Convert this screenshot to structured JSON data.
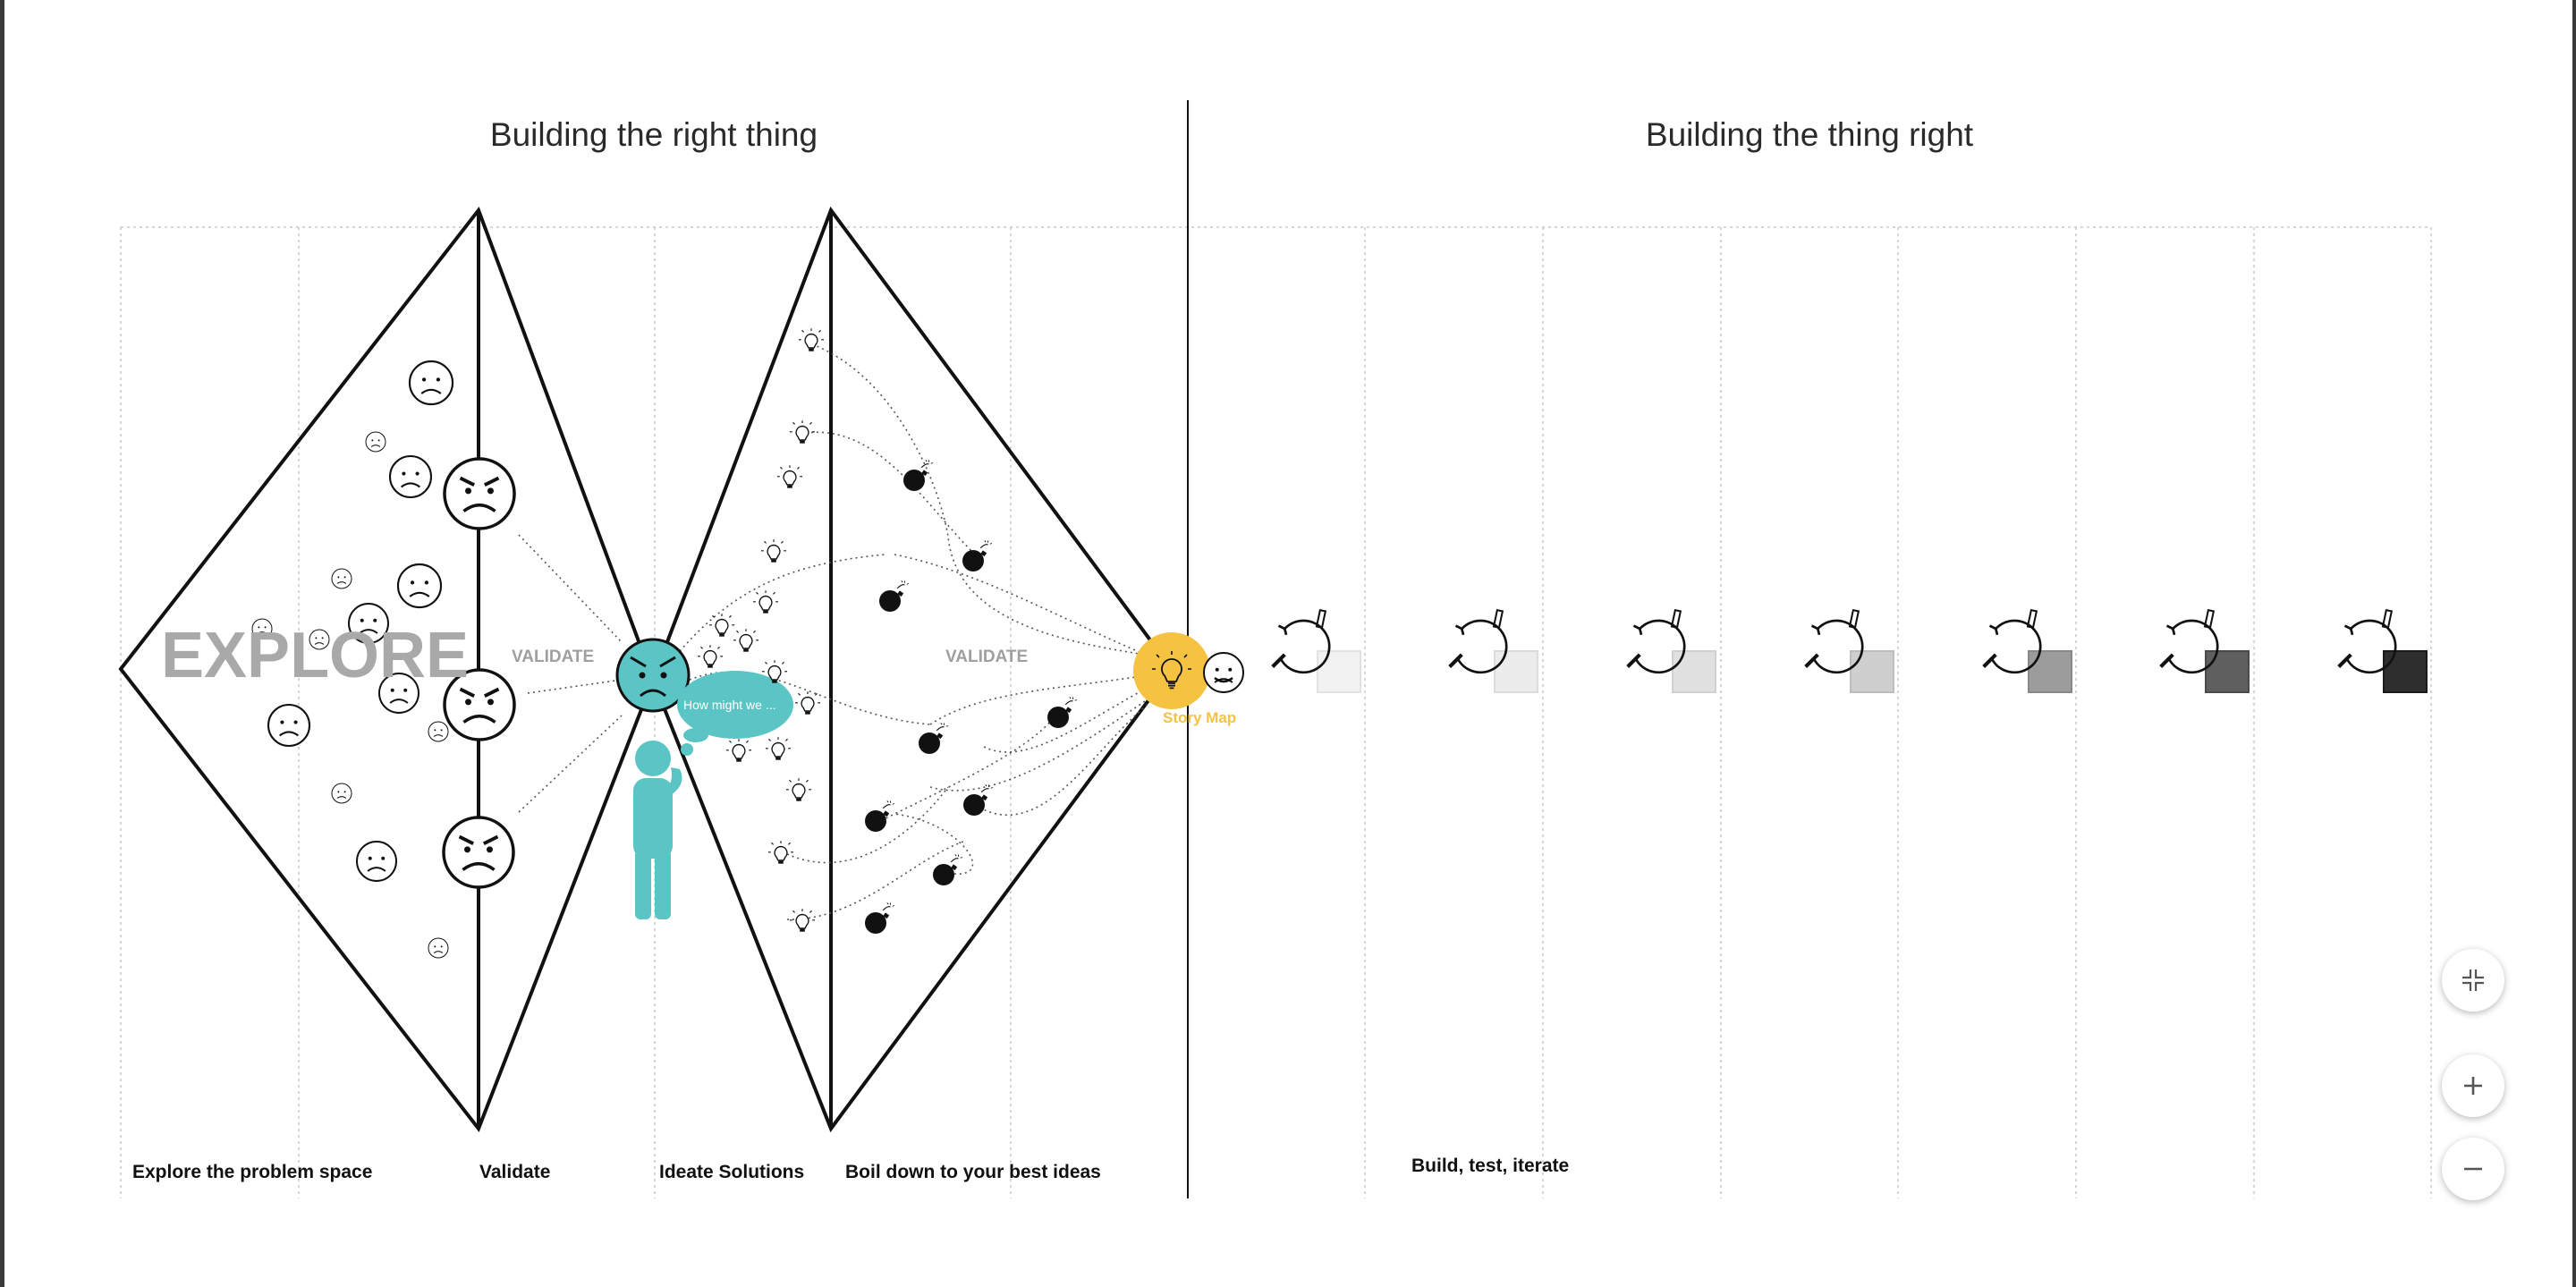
{
  "sections": {
    "left_title": "Building the right thing",
    "right_title": "Building the thing right"
  },
  "diagram": {
    "explore_label": "EXPLORE",
    "validate_label_1": "VALIDATE",
    "validate_label_2": "VALIDATE",
    "thought_bubble": "How might we ...",
    "story_map_label": "Story Map"
  },
  "stages": {
    "explore": "Explore the problem space",
    "validate": "Validate",
    "ideate": "Ideate Solutions",
    "boil": "Boil down to your best ideas",
    "build": "Build, test, iterate"
  },
  "controls": {
    "collapse": "collapse-icon",
    "zoom_in": "plus-icon",
    "zoom_out": "minus-icon"
  },
  "colors": {
    "teal": "#5bc4c4",
    "yellow": "#f5c242",
    "grid": "#c8c8c8",
    "line": "#111111"
  }
}
